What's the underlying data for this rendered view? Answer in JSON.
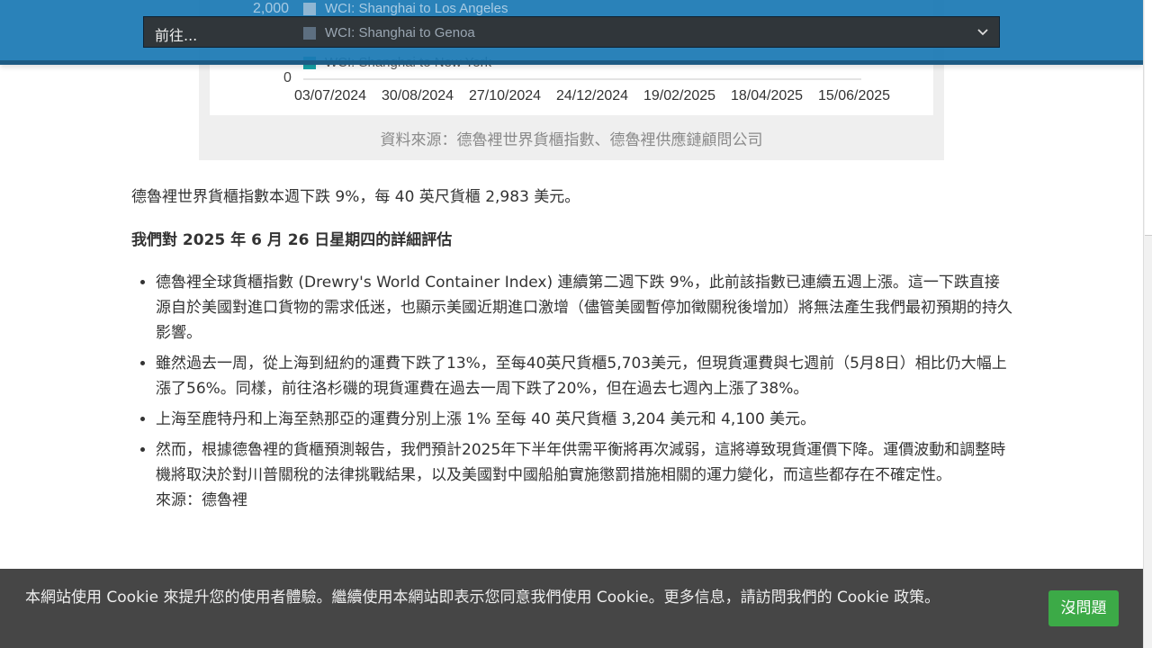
{
  "figure": {
    "y_ticks": [
      "2,000",
      "0"
    ],
    "legend": [
      {
        "label": "WCI: Shanghai to Los Angeles",
        "color": "#a8c6dc"
      },
      {
        "label": "WCI: Shanghai to Genoa",
        "color": "#34495e"
      },
      {
        "label": "WCI: Shanghai to New York",
        "color": "#17a2a8"
      }
    ],
    "x_ticks": [
      "03/07/2024",
      "30/08/2024",
      "27/10/2024",
      "24/12/2024",
      "19/02/2025",
      "18/04/2025",
      "15/06/2025"
    ],
    "caption": "資料來源：德魯裡世界貨櫃指數、德魯裡供應鏈顧問公司"
  },
  "header": {
    "select_value": "前往..."
  },
  "article": {
    "intro": "德魯裡世界貨櫃指數本週下跌 9%，每 40 英尺貨櫃 2,983 美元。",
    "heading": "我們對 2025 年 6 月 26 日星期四的詳細評估",
    "bullets": [
      "德魯裡全球貨櫃指數 (Drewry's World Container Index) 連續第二週下跌 9%，此前該指數已連續五週上漲。這一下跌直接源自於美國對進口貨物的需求低迷，也顯示美國近期進口激增（儘管美國暫停加徵關稅後增加）將無法產生我們最初預期的持久影響。",
      "雖然過去一周，從上海到紐約的運費下跌了13%，至每40英尺貨櫃5,703美元，但現貨運費與七週前（5月8日）相比仍大幅上漲了56%。同樣，前往洛杉磯的現貨運費在過去一周下跌了20%，但在過去七週內上漲了38%。",
      "上海至鹿特丹和上海至熱那亞的運費分別上漲 1% 至每 40 英尺貨櫃 3,204 美元和 4,100 美元。",
      "然而，根據德魯裡的貨櫃預測報告，我們預計2025年下半年供需平衡將再次減弱，這將導致現貨運價下降。運價波動和調整時機將取決於對川普關稅的法律挑戰結果，以及美國對中國船舶實施懲罰措施相關的運力變化，而這些都存在不確定性。"
    ],
    "source": "來源：德魯裡"
  },
  "cookie": {
    "message": "本網站使用 Cookie 來提升您的使用者體驗。繼續使用本網站即表示您同意我們使用 Cookie。更多信息，請訪問我們的 Cookie 政策。",
    "accept_label": "沒問題"
  }
}
